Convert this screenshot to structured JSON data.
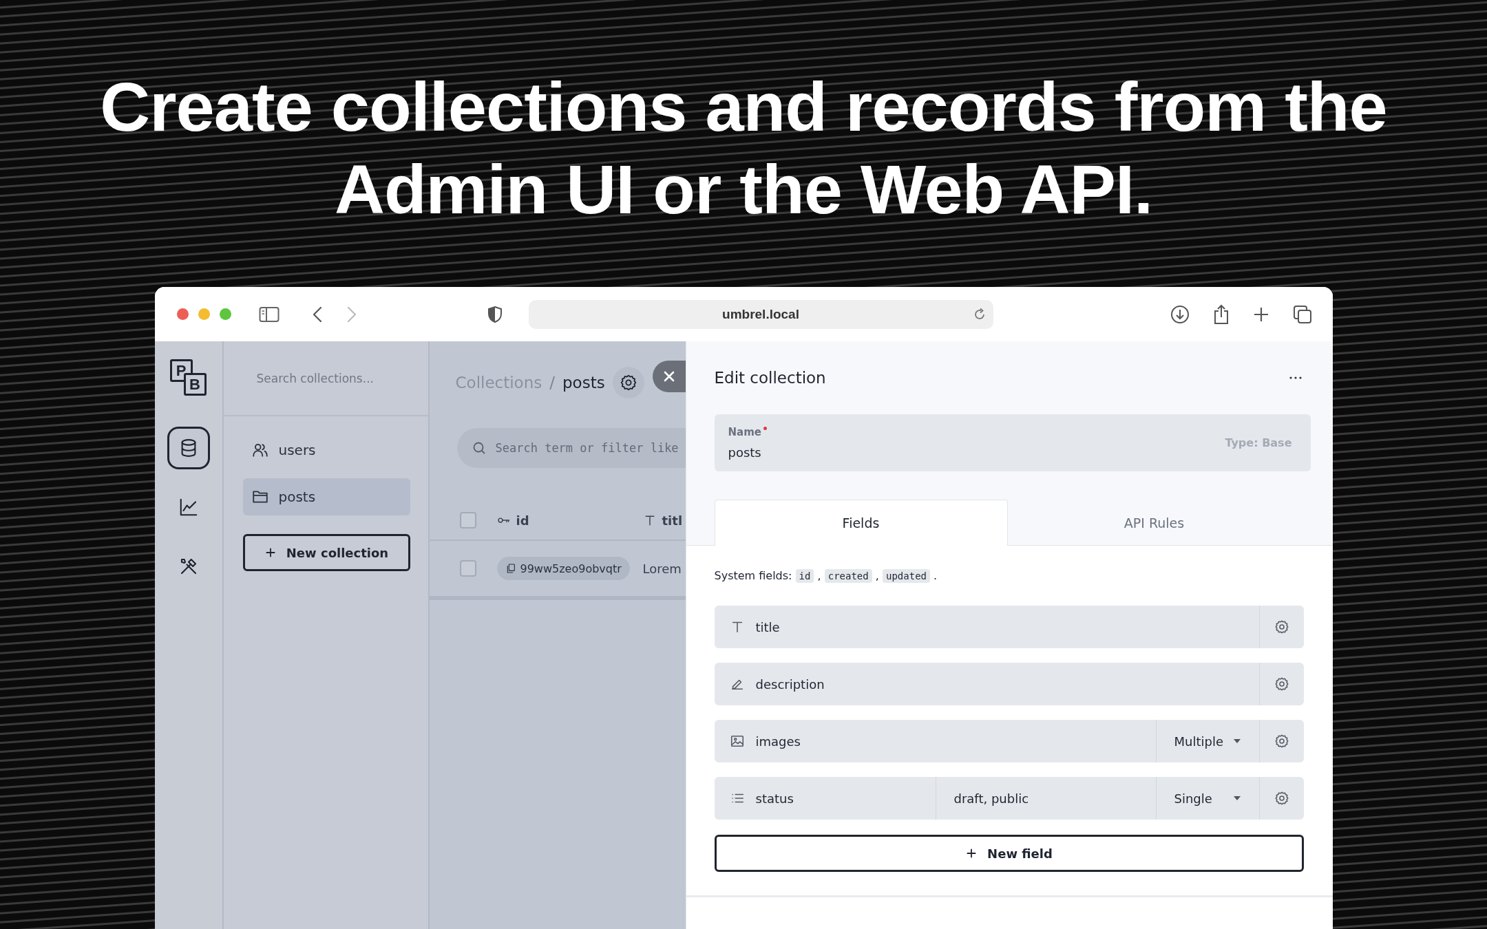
{
  "headline": "Create collections and records from the Admin UI or the Web API.",
  "browser": {
    "url": "umbrel.local"
  },
  "logo": [
    "P",
    "B"
  ],
  "rail": [
    {
      "kind": "database",
      "selected": true
    },
    {
      "kind": "chart",
      "selected": false
    },
    {
      "kind": "tools",
      "selected": false
    }
  ],
  "sidebar": {
    "search_placeholder": "Search collections...",
    "items": [
      {
        "kind": "users",
        "label": "users",
        "selected": false
      },
      {
        "kind": "folder",
        "label": "posts",
        "selected": true
      }
    ],
    "new_button": "New collection"
  },
  "main": {
    "breadcrumb": [
      "Collections",
      "posts"
    ],
    "separator": "/",
    "search_placeholder": "Search term or filter like",
    "columns": [
      {
        "kind": "key",
        "label": "id"
      },
      {
        "kind": "text",
        "label": "titl"
      }
    ],
    "all_checked": false,
    "rows": [
      {
        "cells": [
          "99ww5zeo9obvqtr",
          "Lorem"
        ],
        "checked": false
      }
    ]
  },
  "panel": {
    "title": "Edit collection",
    "name_field": {
      "label": "Name",
      "required": true,
      "value": "posts",
      "type": "Type: Base"
    },
    "tabs": [
      {
        "label": "Fields",
        "selected": true
      },
      {
        "label": "API Rules",
        "selected": false
      }
    ],
    "system_fields": {
      "label": "System fields:",
      "items": [
        "id",
        "created",
        "updated"
      ],
      "separator": ",",
      "end": "."
    },
    "fields": [
      {
        "kind": "text",
        "name": "title"
      },
      {
        "kind": "editor",
        "name": "description"
      },
      {
        "kind": "file",
        "name": "images",
        "option": "Multiple"
      },
      {
        "kind": "select",
        "name": "status",
        "values": "draft, public",
        "option": "Single"
      }
    ],
    "new_field": "New field"
  }
}
